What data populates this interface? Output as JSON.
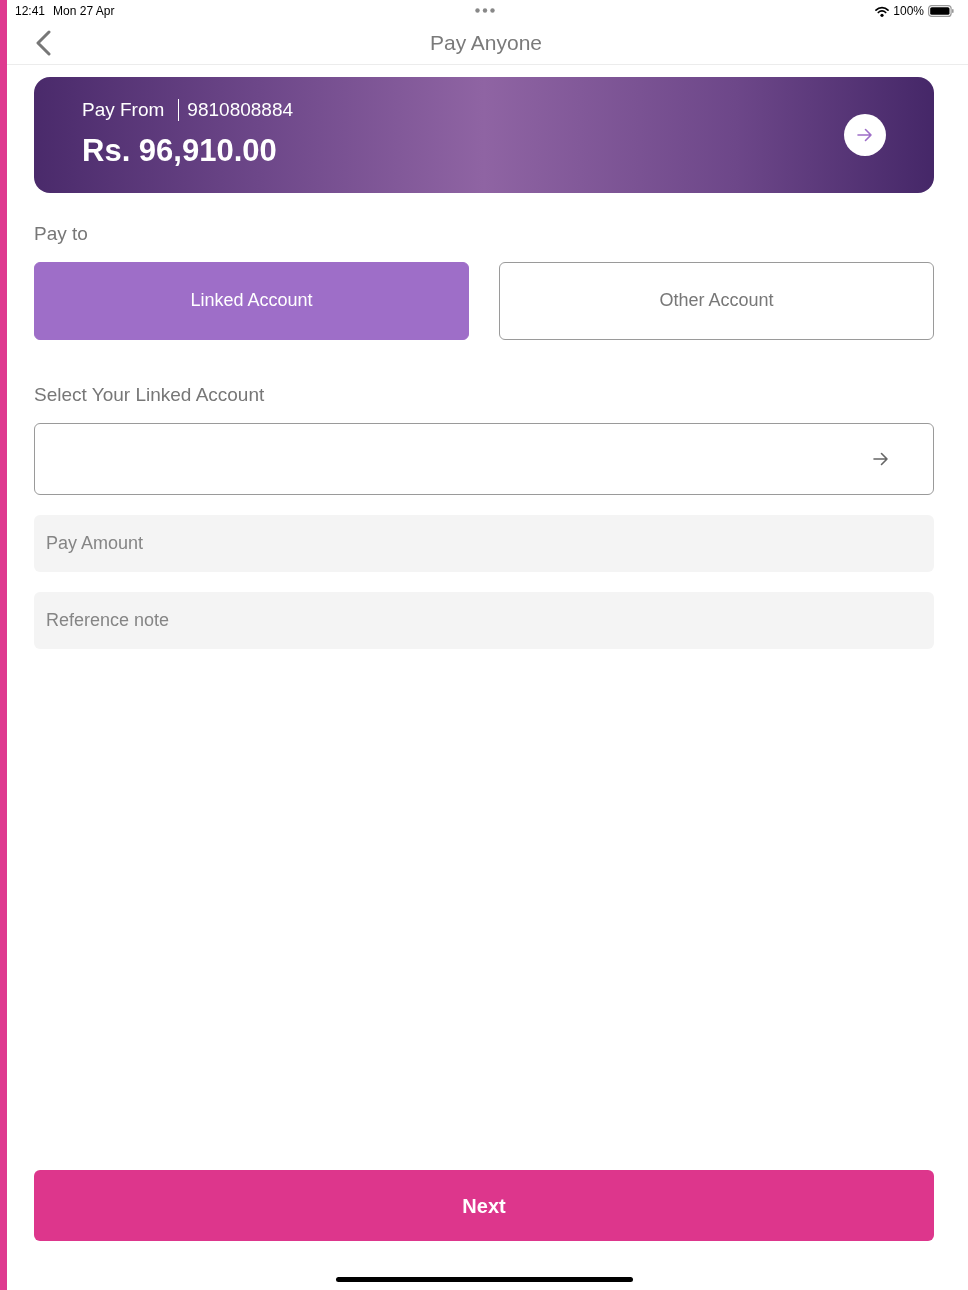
{
  "status_bar": {
    "time": "12:41",
    "date": "Mon 27 Apr",
    "battery": "100%"
  },
  "nav": {
    "title": "Pay Anyone"
  },
  "account_card": {
    "label": "Pay From",
    "number": "9810808884",
    "balance": "Rs. 96,910.00"
  },
  "pay_to": {
    "label": "Pay to",
    "options": [
      {
        "label": "Linked Account",
        "selected": true
      },
      {
        "label": "Other Account",
        "selected": false
      }
    ]
  },
  "linked_account": {
    "label": "Select Your Linked Account"
  },
  "fields": [
    {
      "placeholder": "Pay Amount"
    },
    {
      "placeholder": "Reference note"
    }
  ],
  "next_button": {
    "label": "Next"
  }
}
